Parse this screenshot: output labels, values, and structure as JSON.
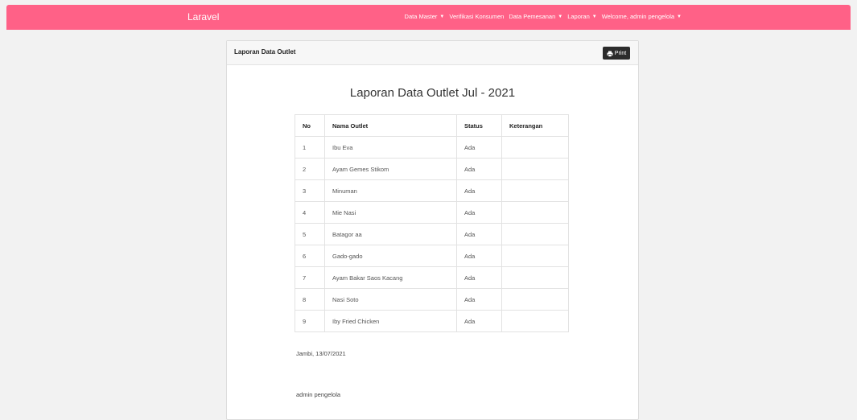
{
  "navbar": {
    "brand": "Laravel",
    "menu": [
      {
        "label": "Data Master",
        "dropdown": true
      },
      {
        "label": "Verifikasi Konsumen",
        "dropdown": false
      },
      {
        "label": "Data Pemesanan",
        "dropdown": true
      },
      {
        "label": "Laporan",
        "dropdown": true
      },
      {
        "label": "Welcome, admin pengelola",
        "dropdown": true
      }
    ],
    "caret": "▼",
    "color": "#ff6187"
  },
  "card": {
    "title": "Laporan Data Outlet",
    "print_label": "Print"
  },
  "report": {
    "title": "Laporan Data Outlet Jul - 2021",
    "headers": [
      "No",
      "Nama Outlet",
      "Status",
      "Keterangan"
    ],
    "rows": [
      [
        "1",
        "Ibu Eva",
        "Ada",
        ""
      ],
      [
        "2",
        "Ayam Gemes Stikom",
        "Ada",
        ""
      ],
      [
        "3",
        "Minuman",
        "Ada",
        ""
      ],
      [
        "4",
        "Mie Nasi",
        "Ada",
        ""
      ],
      [
        "5",
        "Batagor aa",
        "Ada",
        ""
      ],
      [
        "6",
        "Gado-gado",
        "Ada",
        ""
      ],
      [
        "7",
        "Ayam Bakar Saos Kacang",
        "Ada",
        ""
      ],
      [
        "8",
        "Nasi Soto",
        "Ada",
        ""
      ],
      [
        "9",
        "Iby Fried Chicken",
        "Ada",
        ""
      ]
    ],
    "place_date": "Jambi, 13/07/2021",
    "signer": "admin pengelola"
  }
}
